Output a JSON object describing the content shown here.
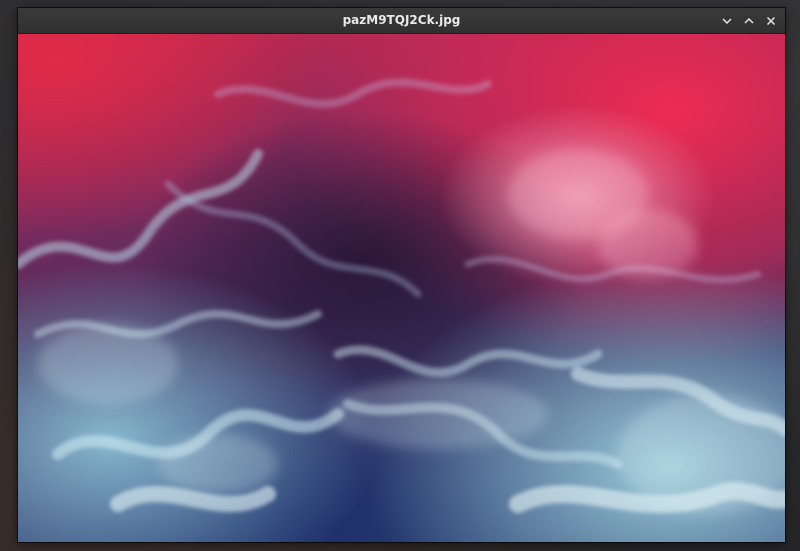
{
  "window": {
    "title": "pazM9TQJ2Ck.jpg"
  },
  "controls": {
    "minimize_icon": "chevron-down-icon",
    "maximize_icon": "chevron-up-icon",
    "close_icon": "close-icon"
  },
  "image": {
    "description_colors": {
      "accent_pink": "#e2264e",
      "deep_purple": "#3b1f4d",
      "smoke_cyan": "#9fd3e0",
      "navy": "#1d2b5c"
    }
  }
}
